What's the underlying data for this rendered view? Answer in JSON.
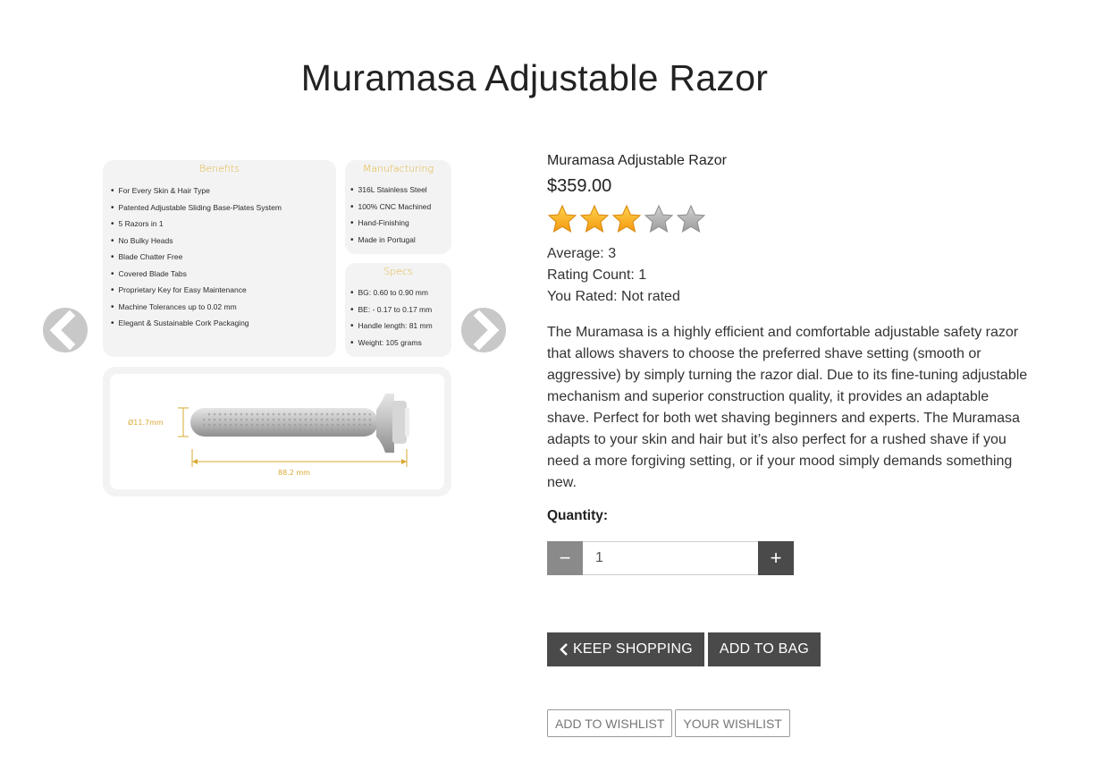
{
  "page": {
    "title": "Muramasa Adjustable Razor"
  },
  "gallery": {
    "prev_icon": "chevron-left-icon",
    "next_icon": "chevron-right-icon",
    "benefits": {
      "title": "Benefits",
      "items": [
        "For Every Skin & Hair Type",
        "Patented Adjustable Sliding Base-Plates System",
        "5 Razors in 1",
        "No Bulky Heads",
        "Blade Chatter Free",
        "Covered Blade Tabs",
        "Proprietary Key for Easy Maintenance",
        "Machine Tolerances up to 0.02 mm",
        "Elegant & Sustainable Cork Packaging"
      ]
    },
    "manufacturing": {
      "title": "Manufacturing",
      "items": [
        "316L Stainless Steel",
        "100% CNC Machined",
        "Hand-Finishing",
        "Made in Portugal"
      ]
    },
    "specs": {
      "title": "Specs",
      "items": [
        "BG: 0.60 to 0.90 mm",
        "BE: - 0.17 to 0.17 mm",
        "Handle length: 81 mm",
        "Weight: 105 grams"
      ]
    },
    "dimensions": {
      "diameter": "Ø11.7mm",
      "length": "88.2 mm"
    },
    "accent_color": "#e0b43a"
  },
  "product": {
    "name": "Muramasa Adjustable Razor",
    "price": "$359.00",
    "rating": {
      "value": 3,
      "max": 5,
      "average_text": "Average: 3",
      "count_text": "Rating Count: 1",
      "user_text": "You Rated: Not rated"
    },
    "description": "The Muramasa is a highly efficient and comfortable adjustable safety razor that allows shavers to choose the preferred shave setting (smooth or aggressive) by simply turning the razor dial. Due to its fine-tuning adjustable mechanism and superior construction quality, it provides an adaptable shave. Perfect for both wet shaving beginners and experts. The Muramasa adapts to your skin and hair but it’s also perfect for a rushed shave if you need a more forgiving setting, or if your mood simply demands something new."
  },
  "quantity": {
    "label": "Quantity:",
    "value": "1",
    "minus": "−",
    "plus": "+"
  },
  "actions": {
    "keep_shopping": "KEEP SHOPPING",
    "keep_shopping_icon": "chevron-left-icon",
    "add_to_bag": "ADD TO BAG",
    "add_to_wishlist": "ADD TO WISHLIST",
    "your_wishlist": "YOUR WISHLIST"
  }
}
